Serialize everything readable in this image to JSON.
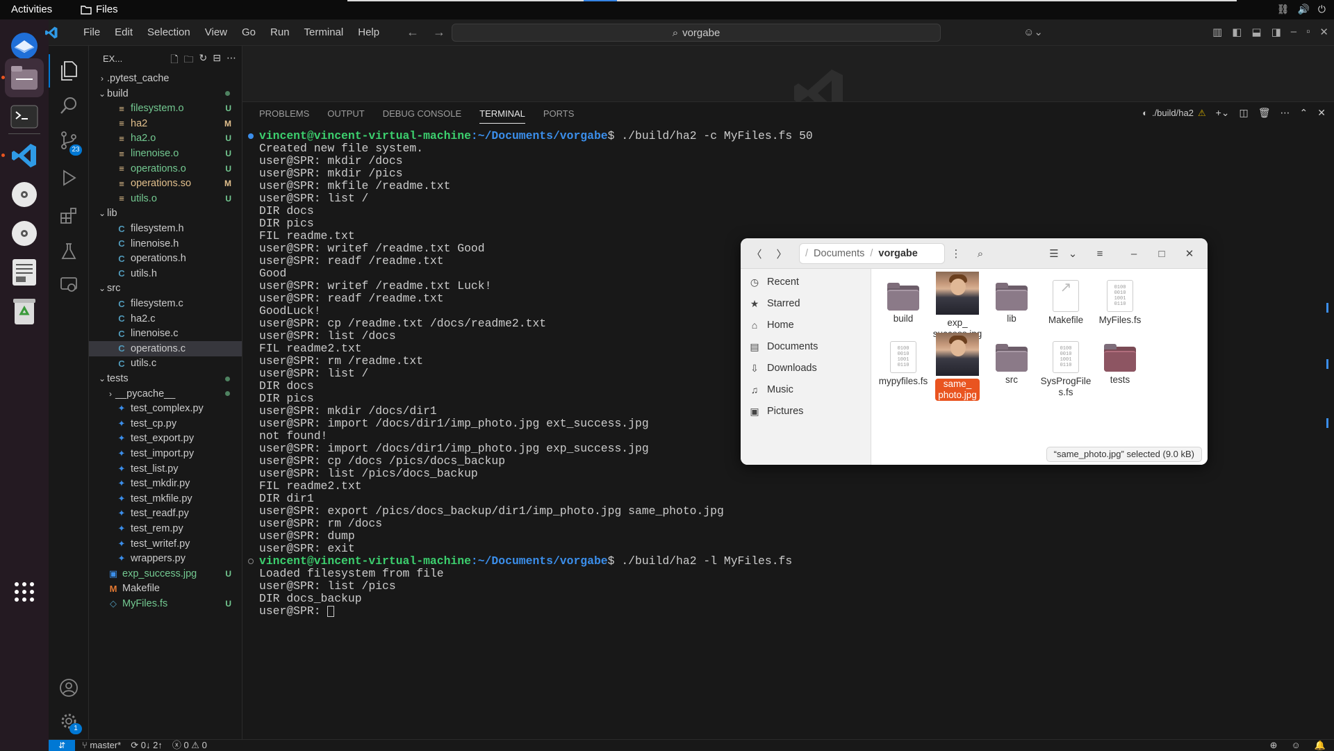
{
  "topbar": {
    "activities": "Activities",
    "app_name": "Files"
  },
  "dock": {
    "items": [
      "thunderbird-icon",
      "files-icon",
      "terminal-icon",
      "vscode-icon",
      "disc-icon",
      "disc-icon",
      "text-editor-icon",
      "trash-icon",
      "app-grid-icon"
    ]
  },
  "vscode": {
    "menu": [
      "File",
      "Edit",
      "Selection",
      "View",
      "Go",
      "Run",
      "Terminal",
      "Help"
    ],
    "search": "vorgabe",
    "explorer_title": "EX...",
    "source_control_badge": "23",
    "settings_badge": "1",
    "tree": [
      {
        "label": ".pytest_cache",
        "type": "folder",
        "indent": 0,
        "open": false
      },
      {
        "label": "build",
        "type": "folder",
        "indent": 0,
        "open": true,
        "dot": true
      },
      {
        "label": "filesystem.o",
        "type": "bin",
        "indent": 1,
        "status": "U"
      },
      {
        "label": "ha2",
        "type": "bin",
        "indent": 1,
        "status": "M"
      },
      {
        "label": "ha2.o",
        "type": "bin",
        "indent": 1,
        "status": "U"
      },
      {
        "label": "linenoise.o",
        "type": "bin",
        "indent": 1,
        "status": "U"
      },
      {
        "label": "operations.o",
        "type": "bin",
        "indent": 1,
        "status": "U"
      },
      {
        "label": "operations.so",
        "type": "bin",
        "indent": 1,
        "status": "M"
      },
      {
        "label": "utils.o",
        "type": "bin",
        "indent": 1,
        "status": "U"
      },
      {
        "label": "lib",
        "type": "folder",
        "indent": 0,
        "open": true
      },
      {
        "label": "filesystem.h",
        "type": "c",
        "indent": 1
      },
      {
        "label": "linenoise.h",
        "type": "c",
        "indent": 1
      },
      {
        "label": "operations.h",
        "type": "c",
        "indent": 1
      },
      {
        "label": "utils.h",
        "type": "c",
        "indent": 1
      },
      {
        "label": "src",
        "type": "folder",
        "indent": 0,
        "open": true
      },
      {
        "label": "filesystem.c",
        "type": "c",
        "indent": 1
      },
      {
        "label": "ha2.c",
        "type": "c",
        "indent": 1
      },
      {
        "label": "linenoise.c",
        "type": "c",
        "indent": 1
      },
      {
        "label": "operations.c",
        "type": "c",
        "indent": 1,
        "selected": true
      },
      {
        "label": "utils.c",
        "type": "c",
        "indent": 1
      },
      {
        "label": "tests",
        "type": "folder",
        "indent": 0,
        "open": true,
        "dot": true
      },
      {
        "label": "__pycache__",
        "type": "folder",
        "indent": 1,
        "open": false,
        "dot": true
      },
      {
        "label": "test_complex.py",
        "type": "py",
        "indent": 1
      },
      {
        "label": "test_cp.py",
        "type": "py",
        "indent": 1
      },
      {
        "label": "test_export.py",
        "type": "py",
        "indent": 1
      },
      {
        "label": "test_import.py",
        "type": "py",
        "indent": 1
      },
      {
        "label": "test_list.py",
        "type": "py",
        "indent": 1
      },
      {
        "label": "test_mkdir.py",
        "type": "py",
        "indent": 1
      },
      {
        "label": "test_mkfile.py",
        "type": "py",
        "indent": 1
      },
      {
        "label": "test_readf.py",
        "type": "py",
        "indent": 1
      },
      {
        "label": "test_rem.py",
        "type": "py",
        "indent": 1
      },
      {
        "label": "test_writef.py",
        "type": "py",
        "indent": 1
      },
      {
        "label": "wrappers.py",
        "type": "py",
        "indent": 1
      },
      {
        "label": "exp_success.jpg",
        "type": "img",
        "indent": 0,
        "status": "U"
      },
      {
        "label": "Makefile",
        "type": "make",
        "indent": 0
      },
      {
        "label": "MyFiles.fs",
        "type": "fs",
        "indent": 0,
        "status": "U"
      }
    ],
    "panel_tabs": [
      "PROBLEMS",
      "OUTPUT",
      "DEBUG CONSOLE",
      "TERMINAL",
      "PORTS"
    ],
    "active_panel_tab": "TERMINAL",
    "terminal_name": "./build/ha2",
    "terminal": [
      {
        "kind": "prompt",
        "user": "vincent@vincent-virtual-machine",
        "path": ":~/Documents/vorgabe",
        "cmd": "$ ./build/ha2 -c MyFiles.fs 50",
        "mark": "blue"
      },
      {
        "kind": "out",
        "text": "Created new file system."
      },
      {
        "kind": "out",
        "text": "user@SPR: mkdir /docs"
      },
      {
        "kind": "out",
        "text": "user@SPR: mkdir /pics"
      },
      {
        "kind": "out",
        "text": "user@SPR: mkfile /readme.txt"
      },
      {
        "kind": "out",
        "text": "user@SPR: list /"
      },
      {
        "kind": "out",
        "text": "DIR docs"
      },
      {
        "kind": "out",
        "text": "DIR pics"
      },
      {
        "kind": "out",
        "text": "FIL readme.txt"
      },
      {
        "kind": "out",
        "text": "user@SPR: writef /readme.txt Good"
      },
      {
        "kind": "out",
        "text": "user@SPR: readf /readme.txt"
      },
      {
        "kind": "out",
        "text": "Good"
      },
      {
        "kind": "out",
        "text": "user@SPR: writef /readme.txt Luck!"
      },
      {
        "kind": "out",
        "text": "user@SPR: readf /readme.txt"
      },
      {
        "kind": "out",
        "text": "GoodLuck!"
      },
      {
        "kind": "out",
        "text": "user@SPR: cp /readme.txt /docs/readme2.txt"
      },
      {
        "kind": "out",
        "text": "user@SPR: list /docs"
      },
      {
        "kind": "out",
        "text": "FIL readme2.txt"
      },
      {
        "kind": "out",
        "text": "user@SPR: rm /readme.txt"
      },
      {
        "kind": "out",
        "text": "user@SPR: list /"
      },
      {
        "kind": "out",
        "text": "DIR docs"
      },
      {
        "kind": "out",
        "text": "DIR pics"
      },
      {
        "kind": "out",
        "text": "user@SPR: mkdir /docs/dir1"
      },
      {
        "kind": "out",
        "text": "user@SPR: import /docs/dir1/imp_photo.jpg ext_success.jpg"
      },
      {
        "kind": "out",
        "text": "not found!"
      },
      {
        "kind": "out",
        "text": "user@SPR: import /docs/dir1/imp_photo.jpg exp_success.jpg"
      },
      {
        "kind": "out",
        "text": "user@SPR: cp /docs /pics/docs_backup"
      },
      {
        "kind": "out",
        "text": "user@SPR: list /pics/docs_backup"
      },
      {
        "kind": "out",
        "text": "FIL readme2.txt"
      },
      {
        "kind": "out",
        "text": "DIR dir1"
      },
      {
        "kind": "out",
        "text": "user@SPR: export /pics/docs_backup/dir1/imp_photo.jpg same_photo.jpg"
      },
      {
        "kind": "out",
        "text": "user@SPR: rm /docs"
      },
      {
        "kind": "out",
        "text": "user@SPR: dump"
      },
      {
        "kind": "out",
        "text": "user@SPR: exit"
      },
      {
        "kind": "prompt",
        "user": "vincent@vincent-virtual-machine",
        "path": ":~/Documents/vorgabe",
        "cmd": "$ ./build/ha2 -l MyFiles.fs",
        "mark": "grey"
      },
      {
        "kind": "out",
        "text": "Loaded filesystem from file"
      },
      {
        "kind": "out",
        "text": "user@SPR: list /pics"
      },
      {
        "kind": "out",
        "text": "DIR docs_backup"
      },
      {
        "kind": "cursor",
        "text": "user@SPR: "
      }
    ],
    "status": {
      "branch": "master*",
      "sync": "0↓ 2↑",
      "problems": "0",
      "warnings": "0"
    }
  },
  "files": {
    "path": [
      "Documents",
      "vorgabe"
    ],
    "sidebar": [
      {
        "label": "Recent",
        "icon": "clock-icon"
      },
      {
        "label": "Starred",
        "icon": "star-icon"
      },
      {
        "label": "Home",
        "icon": "home-icon"
      },
      {
        "label": "Documents",
        "icon": "document-icon"
      },
      {
        "label": "Downloads",
        "icon": "download-icon"
      },
      {
        "label": "Music",
        "icon": "music-icon"
      },
      {
        "label": "Pictures",
        "icon": "picture-icon"
      }
    ],
    "items": [
      {
        "label": "build",
        "kind": "folder"
      },
      {
        "label": "exp_\nsuccess.jpg",
        "kind": "photo"
      },
      {
        "label": "lib",
        "kind": "folder"
      },
      {
        "label": "Makefile",
        "kind": "script"
      },
      {
        "label": "MyFiles.fs",
        "kind": "binary"
      },
      {
        "label": "mypyfiles.fs",
        "kind": "binary"
      },
      {
        "label": "same_\nphoto.jpg",
        "kind": "photo",
        "selected": true
      },
      {
        "label": "src",
        "kind": "folder"
      },
      {
        "label": "SysProgFile\ns.fs",
        "kind": "binary"
      },
      {
        "label": "tests",
        "kind": "folder-red"
      }
    ],
    "status": "“same_photo.jpg” selected (9.0 kB)"
  }
}
